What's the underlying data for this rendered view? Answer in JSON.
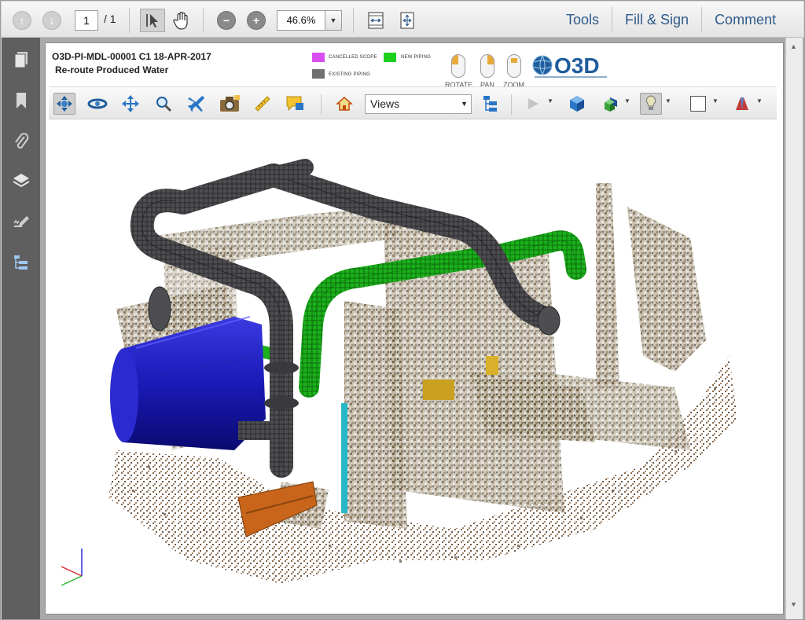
{
  "toolbar": {
    "page_current": "1",
    "page_total": "/ 1",
    "zoom_value": "46.6%",
    "tools_label": "Tools",
    "fill_sign_label": "Fill & Sign",
    "comment_label": "Comment"
  },
  "document": {
    "title": "O3D-PI-MDL-00001 C1 18-APR-2017",
    "subtitle": "Re-route Produced Water",
    "legend": [
      {
        "label": "CANCELLED SCOPE",
        "color": "#d84ef0"
      },
      {
        "label": "NEW PIPING",
        "color": "#1ed01e"
      },
      {
        "label": "EXISTING PIPING",
        "color": "#707070"
      }
    ],
    "mouse_labels": [
      "ROTATE",
      "PAN",
      "ZOOM"
    ],
    "logo_text": "O3D"
  },
  "toolbar3d": {
    "views_label": "Views"
  },
  "colors": {
    "sidebar": "#5f5f5f",
    "new_piping": "#1ed01e",
    "existing_piping": "#707070",
    "vessel": "#1a1aa8",
    "nav_text": "#2e5a8a"
  }
}
